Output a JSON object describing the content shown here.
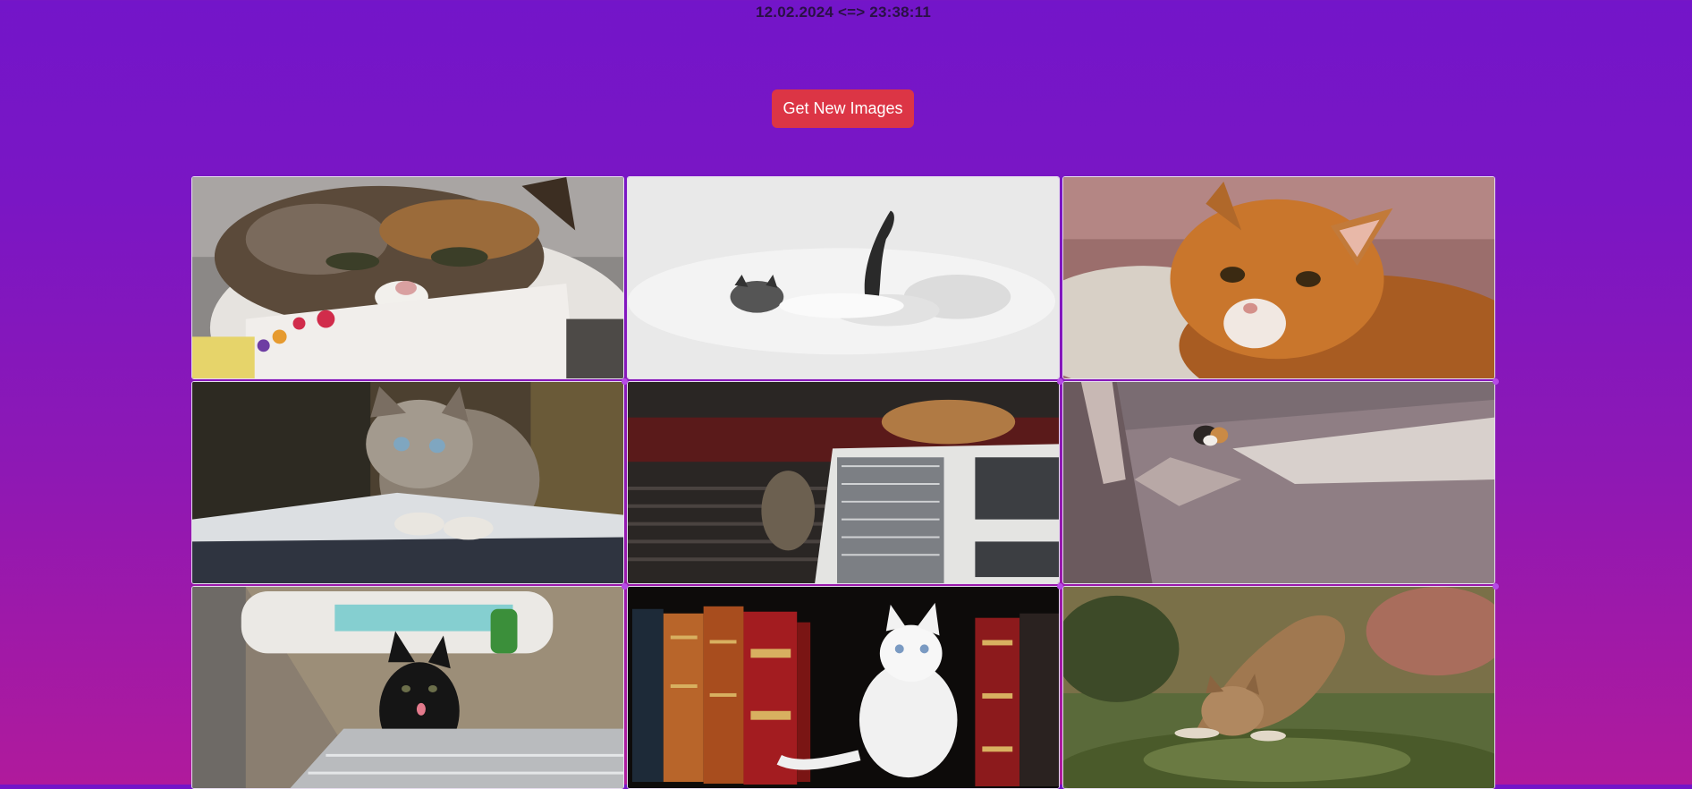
{
  "header": {
    "datetime": "12.02.2024 <=> 23:38:11"
  },
  "toolbar": {
    "get_images_label": "Get New Images"
  },
  "gallery": {
    "images": [
      {
        "subject": "calico cat with floral bib"
      },
      {
        "subject": "cat in deep snow"
      },
      {
        "subject": "orange cat on bed"
      },
      {
        "subject": "tabby kitten on laptop"
      },
      {
        "subject": "cats on air conditioner"
      },
      {
        "subject": "calico cat on pavement"
      },
      {
        "subject": "black kitten with bottle"
      },
      {
        "subject": "white kitten with books"
      },
      {
        "subject": "tabby cat stretching on rock"
      }
    ]
  }
}
